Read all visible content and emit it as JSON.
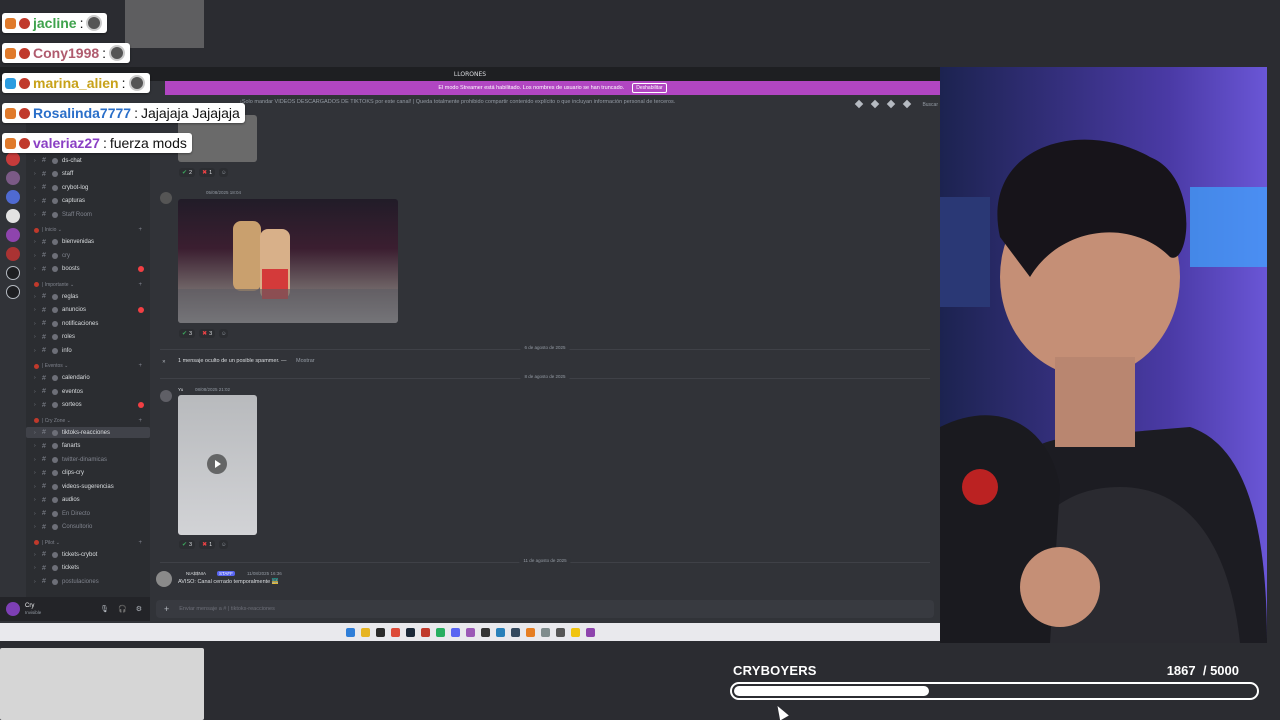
{
  "discord": {
    "window_title": "LLORONES",
    "streamer_banner": "El modo Streamer está habilitado. Los nombres de usuario se han truncado.",
    "streamer_button": "Deshabilitar",
    "channel_topic": "¡Solo mandar VIDEOS DESCARGADOS DE TIKTOKS por este canal! | Queda totalmente prohibido compartir contenido explícito o que incluyan información personal de terceros.",
    "search_label": "Buscar",
    "sidebar": {
      "channels_top": [
        {
          "name": "ds-chat",
          "muted": false
        },
        {
          "name": "staff",
          "muted": false
        },
        {
          "name": "crybot-log",
          "muted": false
        },
        {
          "name": "capturas",
          "muted": false
        },
        {
          "name": "Staff Room",
          "muted": true
        }
      ],
      "cat_inicio": "| Inicio ⌄",
      "inicio": [
        {
          "name": "bienvenidas",
          "muted": false
        },
        {
          "name": "cry",
          "muted": true
        },
        {
          "name": "boosts",
          "muted": false,
          "badge": true
        }
      ],
      "cat_importante": "| Importante ⌄",
      "importante": [
        {
          "name": "reglas",
          "muted": false
        },
        {
          "name": "anuncios",
          "muted": false,
          "badge": true
        },
        {
          "name": "notificaciones",
          "muted": false
        },
        {
          "name": "roles",
          "muted": false
        },
        {
          "name": "info",
          "muted": false
        }
      ],
      "cat_eventos": "| Eventos ⌄",
      "eventos": [
        {
          "name": "calendario",
          "muted": false
        },
        {
          "name": "eventos",
          "muted": false
        },
        {
          "name": "sorteos",
          "muted": false,
          "badge": true
        }
      ],
      "cat_cryzone": "| Cry Zone ⌄",
      "cryzone": [
        {
          "name": "tiktoks-reacciones",
          "muted": false,
          "active": true
        },
        {
          "name": "fanarts",
          "muted": false
        },
        {
          "name": "twitter-dinamicas",
          "muted": true
        },
        {
          "name": "clips-cry",
          "muted": false
        },
        {
          "name": "videos-sugerencias",
          "muted": false
        },
        {
          "name": "audios",
          "muted": false
        },
        {
          "name": "En Directo",
          "muted": true
        },
        {
          "name": "Consultorio",
          "muted": true
        }
      ],
      "cat_pilot": "| Pilot ⌄",
      "pilot": [
        {
          "name": "tickets-crybot",
          "muted": false
        },
        {
          "name": "tickets",
          "muted": false
        },
        {
          "name": "postulaciones",
          "muted": true
        }
      ]
    },
    "user_panel": {
      "name": "Cry",
      "status": "Invisible"
    },
    "messages": {
      "react1": {
        "ok": "2",
        "no": "1"
      },
      "msg2_meta": "05/08/2025 18:04",
      "react2": {
        "ok": "3",
        "no": "3"
      },
      "divider1": "6 de agosto de 2025",
      "hidden_msg": "1 mensaje oculto de un posible spammer. —",
      "hidden_show": "Mostrar",
      "divider2": "8 de agosto de 2025",
      "msg3_user": "Yu",
      "msg3_meta": "08/08/2025 21:02",
      "react3": {
        "ok": "3",
        "no": "1"
      },
      "divider3": "11 de agosto de 2025",
      "msg4_user": "NIA$$NIA",
      "msg4_tag": "STAFF",
      "msg4_meta": "11/08/2025 16:36",
      "msg4_text": "AVISO: Canal cerrado temporalmente 🚟"
    },
    "composer_placeholder": "Enviar mensaje a #  | tiktoks-reacciones"
  },
  "chat": [
    {
      "user": "jacline",
      "color": "#3fa34d",
      "msg": ""
    },
    {
      "user": "Cony1998",
      "color": "#b05b6e",
      "msg": ""
    },
    {
      "user": "marina_alien",
      "color": "#c8a21a",
      "msg": ""
    },
    {
      "user": "Rosalinda7777",
      "color": "#2a6fc9",
      "msg": "Jajajaja Jajajaja"
    },
    {
      "user": "valeriaz27",
      "color": "#8a3fc4",
      "msg": "fuerza mods"
    }
  ],
  "goal": {
    "title": "CRYBOYERS",
    "current": "1867",
    "target": "/ 5000",
    "progress": 0.3734
  }
}
